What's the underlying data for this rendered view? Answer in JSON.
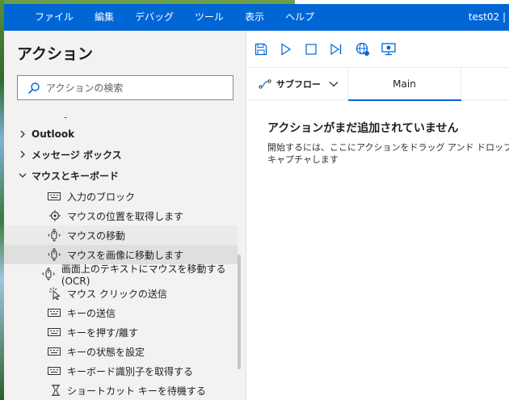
{
  "menu": {
    "items": [
      "ファイル",
      "編集",
      "デバッグ",
      "ツール",
      "表示",
      "ヘルプ"
    ],
    "user": "test02 |"
  },
  "panel": {
    "title": "アクション",
    "search_placeholder": "アクションの検索",
    "dash": "-",
    "categories": [
      {
        "label": "Outlook",
        "expanded": false
      },
      {
        "label": "メッセージ ボックス",
        "expanded": false
      },
      {
        "label": "マウスとキーボード",
        "expanded": true
      }
    ],
    "actions": [
      {
        "label": "入力のブロック",
        "icon": "keyboard-icon"
      },
      {
        "label": "マウスの位置を取得します",
        "icon": "crosshair-icon"
      },
      {
        "label": "マウスの移動",
        "icon": "mouse-move-icon",
        "state": "hover"
      },
      {
        "label": "マウスを画像に移動します",
        "icon": "mouse-move-icon",
        "state": "selected"
      },
      {
        "label": "画面上のテキストにマウスを移動する (OCR)",
        "icon": "mouse-move-icon"
      },
      {
        "label": "マウス クリックの送信",
        "icon": "mouse-click-icon"
      },
      {
        "label": "キーの送信",
        "icon": "keyboard-icon"
      },
      {
        "label": "キーを押す/離す",
        "icon": "keyboard-icon"
      },
      {
        "label": "キーの状態を設定",
        "icon": "keyboard-icon"
      },
      {
        "label": "キーボード識別子を取得する",
        "icon": "keyboard-icon"
      },
      {
        "label": "ショートカット キーを待機する",
        "icon": "hourglass-icon"
      }
    ]
  },
  "toolbar": {
    "buttons": [
      "save-icon",
      "run-icon",
      "stop-icon",
      "step-icon",
      "web-recorder-icon",
      "desktop-recorder-icon"
    ]
  },
  "tabs": {
    "subflow_label": "サブフロー",
    "main_label": "Main"
  },
  "canvas": {
    "empty_title": "アクションがまだ追加されていません",
    "empty_desc": "開始するには、ここにアクションをドラッグ アンド ドロップするか、レコーダーでキャプチャします"
  },
  "colors": {
    "accent": "#0066d6",
    "panel_bg": "#f3f2f1",
    "selected_bg": "#e1dfdd"
  }
}
